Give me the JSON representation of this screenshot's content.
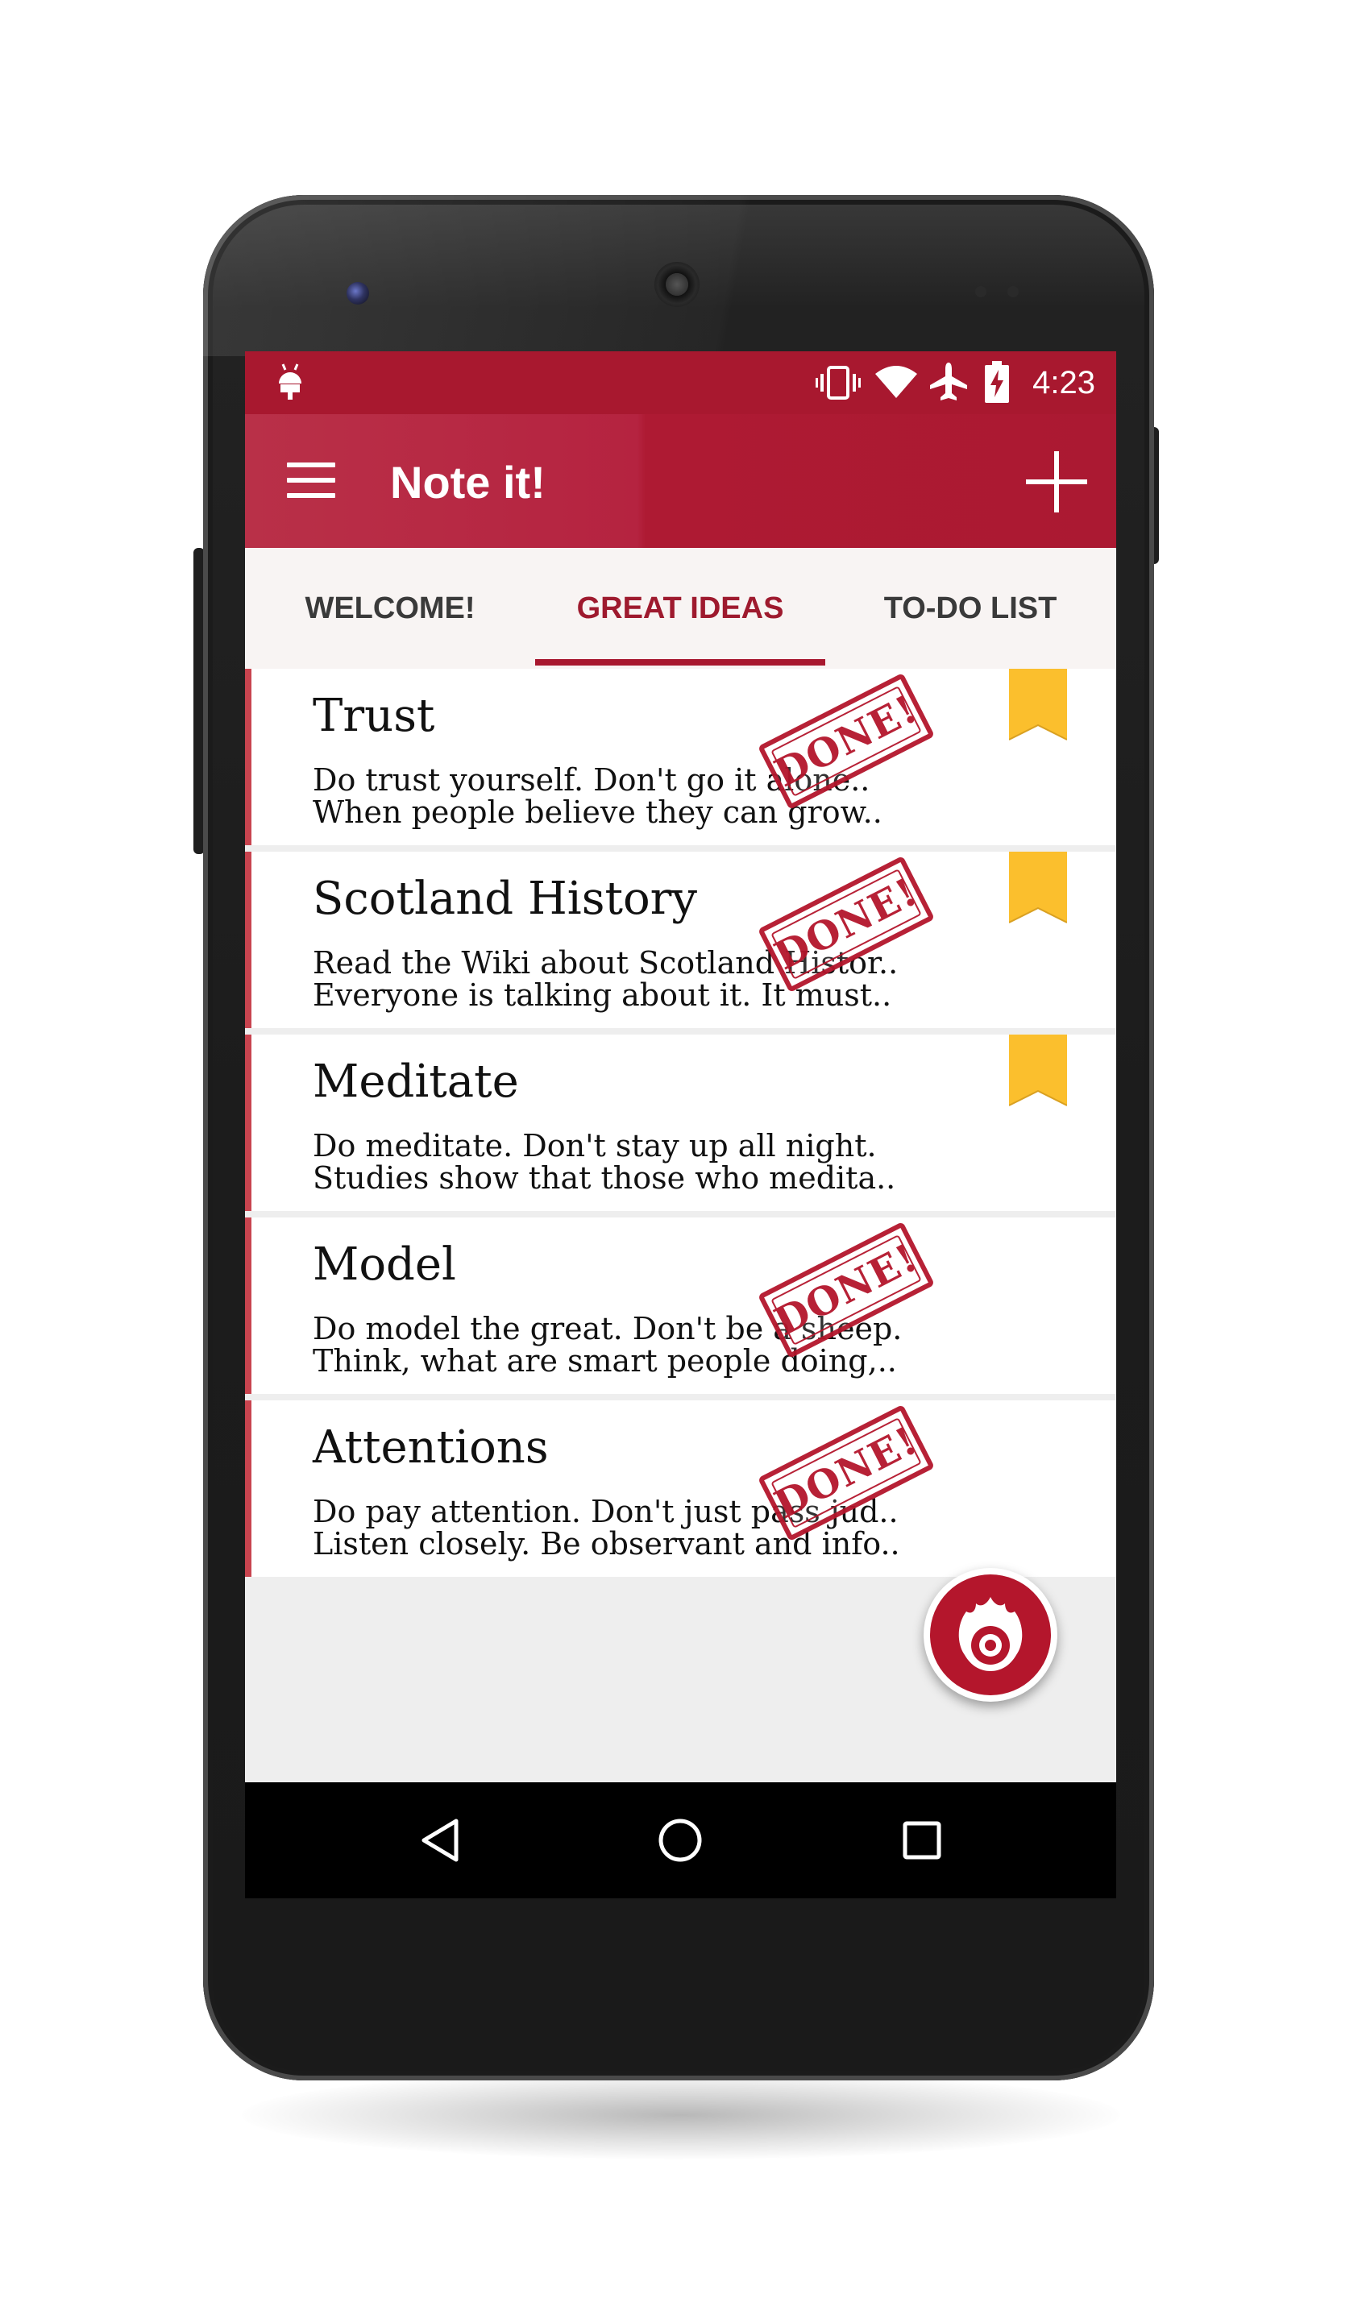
{
  "status_bar": {
    "time": "4:23",
    "icons": [
      "android-notification-icon",
      "vibrate-icon",
      "wifi-icon",
      "airplane-icon",
      "battery-charging-icon"
    ]
  },
  "app_bar": {
    "title": "Note it!",
    "menu_icon": "hamburger-menu-icon",
    "add_icon": "plus-icon"
  },
  "tabs": [
    {
      "label": "WELCOME!",
      "active": false
    },
    {
      "label": "GREAT IDEAS",
      "active": true
    },
    {
      "label": "TO-DO LIST",
      "active": false
    }
  ],
  "notes": [
    {
      "title": "Trust",
      "line1": "Do trust yourself. Don't go it alone..",
      "line2": "When people believe they can grow..",
      "bookmarked": true,
      "done": true
    },
    {
      "title": "Scotland History",
      "line1": "Read the Wiki about Scotland Histor..",
      "line2": "Everyone is talking about it. It must..",
      "bookmarked": true,
      "done": true
    },
    {
      "title": "Meditate",
      "line1": "Do meditate. Don't stay up all night.",
      "line2": "Studies show that those who medita..",
      "bookmarked": true,
      "done": false
    },
    {
      "title": "Model",
      "line1": "Do model the great. Don't be a sheep.",
      "line2": "Think, what are smart people doing,..",
      "bookmarked": false,
      "done": true
    },
    {
      "title": "Attentions",
      "line1": "Do pay attention. Don't just pass jud..",
      "line2": "Listen closely. Be observant and info..",
      "bookmarked": false,
      "done": true
    }
  ],
  "stamp_text": "DONE!",
  "fab_icon": "flame-target-icon",
  "nav_bar": {
    "icons": [
      "back-triangle-icon",
      "home-circle-icon",
      "recents-square-icon"
    ]
  },
  "colors": {
    "primary": "#ab1932",
    "accent_bookmark": "#fbbf2d",
    "stamp": "#b4162c",
    "card_bar": "#c8444f"
  }
}
